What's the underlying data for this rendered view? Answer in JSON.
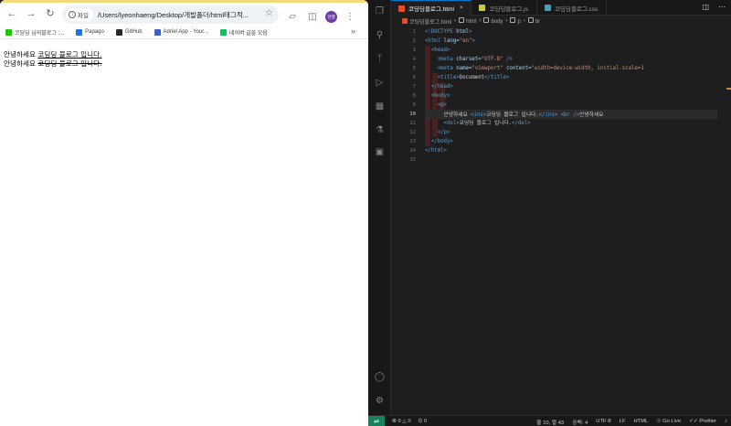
{
  "browser": {
    "info_label": "파일",
    "url": "/Users/lyeonhaeng/Desktop/개발폴더/html태그적...",
    "profile_label": "현행",
    "bookmarks": [
      {
        "label": "코딩딩 님의블로그 :...",
        "color": "#1ec800"
      },
      {
        "label": "Papago",
        "color": "#1a73e8"
      },
      {
        "label": "GitHub",
        "color": "#24292e"
      },
      {
        "label": "Adriel App - Your...",
        "color": "#3b5bdb"
      },
      {
        "label": "네이버 글꼴 모음",
        "color": "#03c75a"
      }
    ],
    "content": {
      "line1_plain": "안녕하세요 ",
      "line1_ins": "코딩딩 블로그 입니다.",
      "line2_plain": "안녕하세요 ",
      "line2_del": "코딩딩 블로그 입니다."
    }
  },
  "editor": {
    "tabs": [
      {
        "label": "코딩딩블로그.html",
        "color": "#e44d26",
        "active": true
      },
      {
        "label": "코딩딩블로그.js",
        "color": "#cbcb41",
        "active": false
      },
      {
        "label": "코딩딩블로그.css",
        "color": "#519aba",
        "active": false
      }
    ],
    "breadcrumb": [
      "코딩딩블로그.html",
      "html",
      "body",
      "p",
      "br"
    ],
    "line_numbers": [
      "1",
      "2",
      "3",
      "4",
      "5",
      "6",
      "7",
      "8",
      "9",
      "10",
      "11",
      "12",
      "13",
      "14",
      "15"
    ],
    "current_line": 10,
    "code": [
      [
        [
          "tg",
          "<!DOCTYPE "
        ],
        [
          "at",
          "html"
        ],
        [
          "tg",
          ">"
        ]
      ],
      [
        [
          "tg",
          "<html "
        ],
        [
          "at",
          "lang"
        ],
        [
          "tx",
          "="
        ],
        [
          "st",
          "\"en\""
        ],
        [
          "tg",
          ">"
        ]
      ],
      [
        [
          "tx",
          "  "
        ],
        [
          "tg",
          "<head>"
        ]
      ],
      [
        [
          "tx",
          "    "
        ],
        [
          "tg",
          "<meta "
        ],
        [
          "at",
          "charset"
        ],
        [
          "tx",
          "="
        ],
        [
          "st",
          "\"UTF-8\""
        ],
        [
          "tg",
          " />"
        ]
      ],
      [
        [
          "tx",
          "    "
        ],
        [
          "tg",
          "<meta "
        ],
        [
          "at",
          "name"
        ],
        [
          "tx",
          "="
        ],
        [
          "st",
          "\"viewport\""
        ],
        [
          "tx",
          " "
        ],
        [
          "at",
          "content"
        ],
        [
          "tx",
          "="
        ],
        [
          "st",
          "\"width=device-width, initial-scale=1"
        ]
      ],
      [
        [
          "tx",
          "    "
        ],
        [
          "tg",
          "<title>"
        ],
        [
          "tx",
          "Document"
        ],
        [
          "tg",
          "</title>"
        ]
      ],
      [
        [
          "tx",
          "  "
        ],
        [
          "tg",
          "</head>"
        ]
      ],
      [
        [
          "tx",
          "  "
        ],
        [
          "tg",
          "<body>"
        ]
      ],
      [
        [
          "tx",
          "    "
        ],
        [
          "tg",
          "<p>"
        ]
      ],
      [
        [
          "tx",
          "      안녕하세요 "
        ],
        [
          "tg",
          "<ins>"
        ],
        [
          "tx",
          "코딩딩 블로그 입니다."
        ],
        [
          "tg",
          "</ins>"
        ],
        [
          "tx",
          " "
        ],
        [
          "tg",
          "<br />"
        ],
        [
          "tx",
          "안녕하세요"
        ]
      ],
      [
        [
          "tx",
          "      "
        ],
        [
          "tg",
          "<del>"
        ],
        [
          "tx",
          "코딩딩 블로그 입니다."
        ],
        [
          "tg",
          "</del>"
        ]
      ],
      [
        [
          "tx",
          "    "
        ],
        [
          "tg",
          "</p>"
        ]
      ],
      [
        [
          "tx",
          "  "
        ],
        [
          "tg",
          "</body>"
        ]
      ],
      [
        [
          "tg",
          "</html>"
        ]
      ],
      []
    ]
  },
  "statusbar": {
    "errors": "0",
    "warnings": "0",
    "ports": "0",
    "position": "줄 10, 열 43",
    "spaces": "공백: 4",
    "encoding": "UTF-8",
    "eol": "LF",
    "language": "HTML",
    "golive": "Go Live",
    "prettier": "Prettier"
  }
}
